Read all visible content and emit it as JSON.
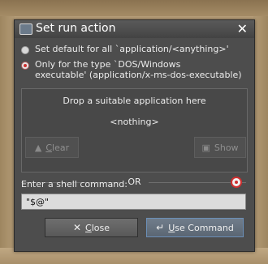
{
  "window": {
    "title": "Set run action",
    "close_glyph": "✕"
  },
  "options": [
    {
      "label": "Set default for all `application/<anything>'",
      "selected": false
    },
    {
      "label": "Only for the type `DOS/Windows",
      "label_line2": "executable' (application/x-ms-dos-executable)",
      "selected": true
    }
  ],
  "app_panel": {
    "hint": "Drop a suitable application here",
    "current": "<nothing>",
    "clear_label": "Clear",
    "clear_underline": "C",
    "clear_rest": "lear",
    "show_label": "Show"
  },
  "or_text": "OR",
  "shell": {
    "label": "Enter a shell command:",
    "value": "\"$@\""
  },
  "buttons": {
    "close_underline": "C",
    "close_rest": "lose",
    "use_underline": "U",
    "use_rest": "se Command"
  },
  "icons": {
    "window": "window-icon",
    "help": "lifebuoy-help-icon",
    "close_button": "x-icon",
    "use_command": "enter-arrow-icon",
    "clear": "broom-icon",
    "show": "show-window-icon"
  }
}
